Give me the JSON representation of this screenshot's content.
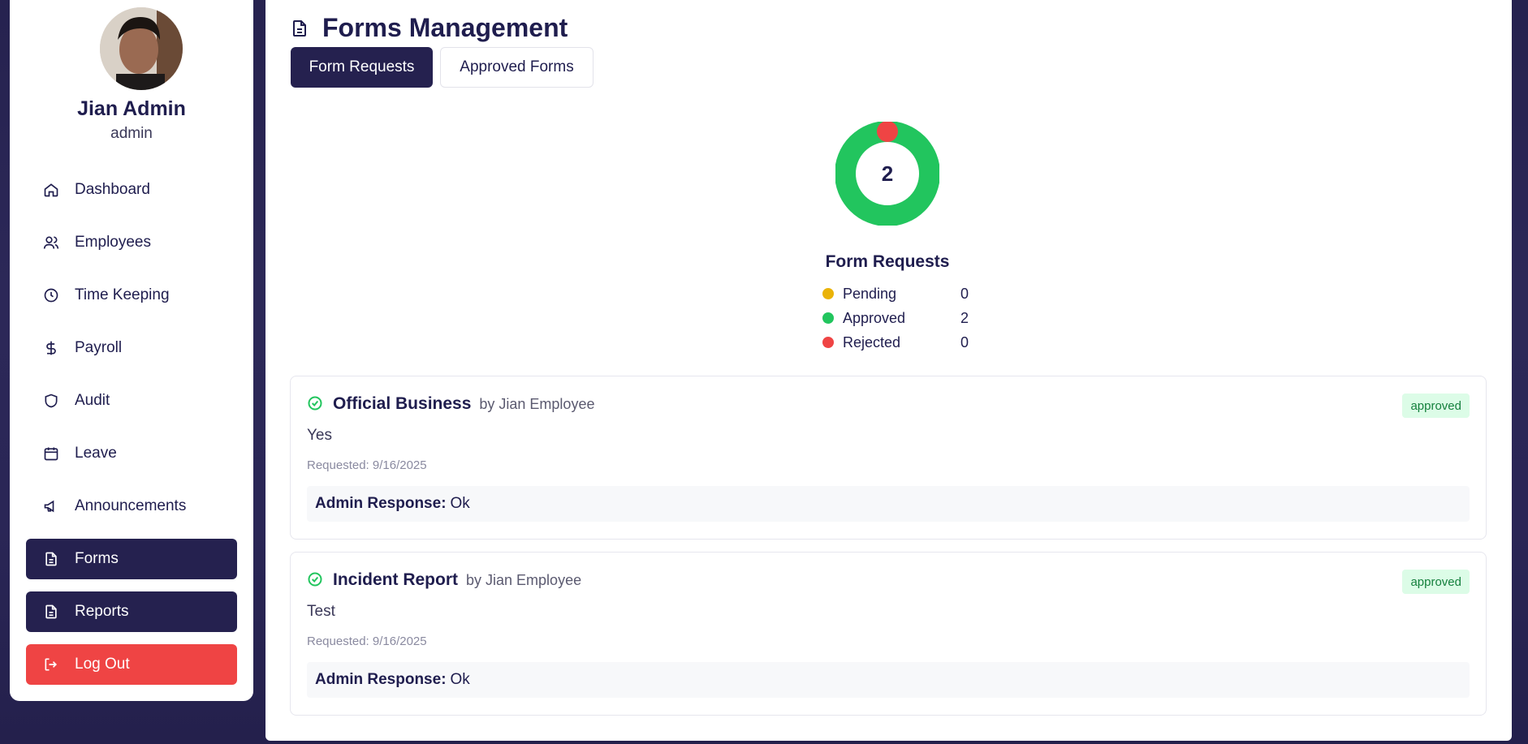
{
  "profile": {
    "name": "Jian Admin",
    "role": "admin"
  },
  "sidebar": {
    "items": [
      {
        "label": "Dashboard",
        "icon": "home-icon"
      },
      {
        "label": "Employees",
        "icon": "users-icon"
      },
      {
        "label": "Time Keeping",
        "icon": "clock-icon"
      },
      {
        "label": "Payroll",
        "icon": "dollar-icon"
      },
      {
        "label": "Audit",
        "icon": "shield-icon"
      },
      {
        "label": "Leave",
        "icon": "calendar-icon"
      },
      {
        "label": "Announcements",
        "icon": "megaphone-icon"
      },
      {
        "label": "Forms",
        "icon": "file-icon",
        "active": true
      },
      {
        "label": "Reports",
        "icon": "file-icon",
        "active": true
      },
      {
        "label": "Log Out",
        "icon": "logout-icon"
      }
    ]
  },
  "page": {
    "title": "Forms Management"
  },
  "tabs": {
    "form_requests": "Form Requests",
    "approved_forms": "Approved Forms"
  },
  "chart_data": {
    "type": "pie",
    "title": "Form Requests",
    "center_label": "2",
    "categories": [
      "Pending",
      "Approved",
      "Rejected"
    ],
    "values": [
      0,
      2,
      0
    ],
    "colors": [
      "#eab308",
      "#22c55e",
      "#ef4444"
    ]
  },
  "cards": [
    {
      "title": "Official Business",
      "by": "by Jian Employee",
      "status": "approved",
      "body": "Yes",
      "requested": "Requested: 9/16/2025",
      "response_label": "Admin Response:",
      "response": "Ok"
    },
    {
      "title": "Incident Report",
      "by": "by Jian Employee",
      "status": "approved",
      "body": "Test",
      "requested": "Requested: 9/16/2025",
      "response_label": "Admin Response:",
      "response": "Ok"
    }
  ],
  "colors": {
    "brand": "#25214f",
    "danger": "#ef4444",
    "success": "#22c55e",
    "pending": "#eab308"
  }
}
